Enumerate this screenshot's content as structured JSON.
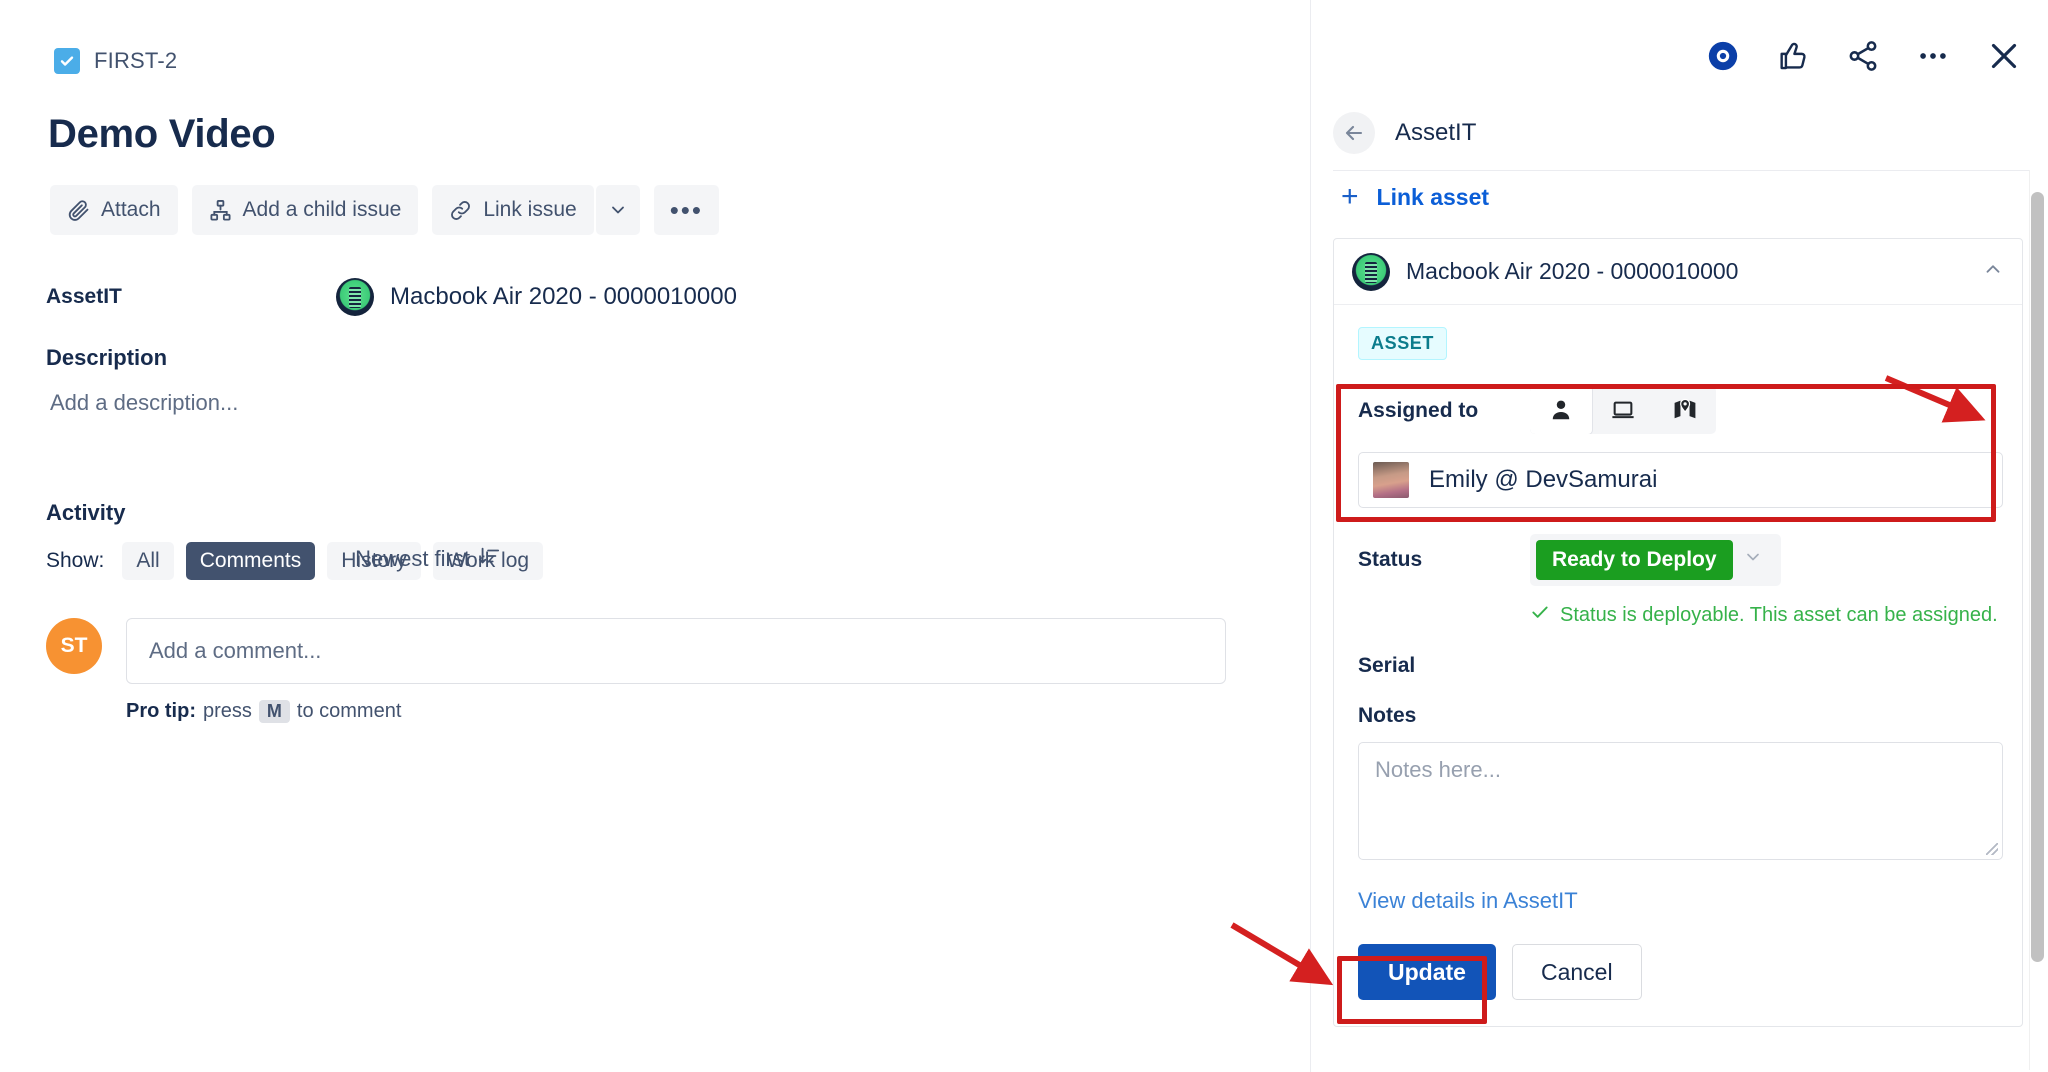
{
  "issue": {
    "key": "FIRST-2",
    "type_icon": "task-check-icon",
    "title": "Demo Video",
    "toolbar": {
      "attach": "Attach",
      "add_child": "Add a child issue",
      "link_issue": "Link issue",
      "caret_icon": "chevron-down-icon",
      "more_icon": "more-actions-icon",
      "more_label": "•••"
    },
    "fields": {
      "assetit_label": "AssetIT",
      "assetit_value": "Macbook Air 2020 - 0000010000",
      "description_label": "Description",
      "description_placeholder": "Add a description..."
    },
    "activity": {
      "heading": "Activity",
      "show_label": "Show:",
      "filters": [
        {
          "label": "All",
          "active": false
        },
        {
          "label": "Comments",
          "active": true
        },
        {
          "label": "History",
          "active": false
        },
        {
          "label": "Work log",
          "active": false
        }
      ],
      "sort_label": "Newest first",
      "sort_icon": "sort-descending-icon",
      "avatar_initials": "ST",
      "comment_placeholder": "Add a comment...",
      "protip_prefix": "Pro tip:",
      "protip_mid": "press",
      "protip_key": "M",
      "protip_suffix": "to comment"
    }
  },
  "panel": {
    "top_icons": [
      {
        "name": "watch-eye-icon"
      },
      {
        "name": "thumbs-up-icon"
      },
      {
        "name": "share-icon"
      },
      {
        "name": "more-options-icon"
      },
      {
        "name": "close-icon"
      }
    ],
    "back_icon": "back-arrow-icon",
    "title": "AssetIT",
    "link_asset_label": "Link asset",
    "link_asset_icon": "plus-icon",
    "asset": {
      "icon": "asset-avatar-icon",
      "title": "Macbook Air 2020 - 0000010000",
      "collapse_icon": "chevron-up-icon",
      "badge": "ASSET",
      "assigned_to_label": "Assigned to",
      "assign_targets": [
        {
          "name": "person-icon",
          "selected": true
        },
        {
          "name": "laptop-icon",
          "selected": false
        },
        {
          "name": "map-location-icon",
          "selected": false
        }
      ],
      "assignee_name": "Emily @ DevSamurai",
      "status_label": "Status",
      "status_value": "Ready to Deploy",
      "status_caret_icon": "chevron-down-icon",
      "status_hint": "Status is deployable. This asset can be assigned.",
      "status_hint_icon": "check-icon",
      "serial_label": "Serial",
      "serial_value": "",
      "notes_label": "Notes",
      "notes_placeholder": "Notes here...",
      "view_details_label": "View details in AssetIT",
      "update_label": "Update",
      "cancel_label": "Cancel"
    }
  },
  "colors": {
    "accent_blue": "#1254B8",
    "link_blue": "#3B82D6",
    "status_green": "#1B9E20",
    "hint_green": "#36B24A",
    "badge_bg": "#E6FCFF",
    "badge_text": "#0B7C8C",
    "annotation_red": "#CE1B1B",
    "avatar_orange": "#F79232",
    "chip_active_bg": "#42526E"
  },
  "annotations": {
    "highlight_assigned_to": "red-box-assigned-to",
    "highlight_update": "red-box-update-button",
    "arrow_to_assigned": "red-arrow-assigned-to",
    "arrow_to_update": "red-arrow-update"
  }
}
